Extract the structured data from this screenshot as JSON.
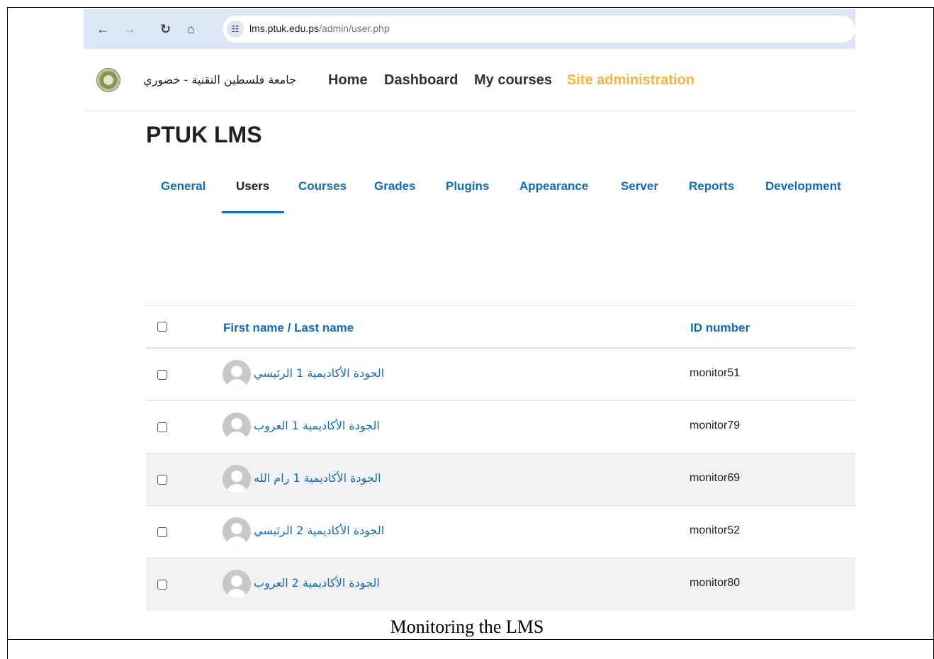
{
  "browser": {
    "url_host": "lms.ptuk.edu.ps",
    "url_path": "/admin/user.php"
  },
  "header": {
    "site_name": "جامعة فلسطين التقنية - خضوري",
    "nav": [
      "Home",
      "Dashboard",
      "My courses",
      "Site administration"
    ],
    "active_nav": "Site administration",
    "active_color": "#f0b740"
  },
  "page": {
    "title": "PTUK LMS",
    "tabs": [
      "General",
      "Users",
      "Courses",
      "Grades",
      "Plugins",
      "Appearance",
      "Server",
      "Reports",
      "Development"
    ],
    "active_tab": "Users"
  },
  "table": {
    "headers": {
      "name_first": "First name",
      "name_sep": " / ",
      "name_last": "Last name",
      "id": "ID number"
    },
    "rows": [
      {
        "name": "الجودة الأكاديمية 1 الرئيسي",
        "id": "monitor51"
      },
      {
        "name": "الجودة الأكاديمية 1 العروب",
        "id": "monitor79"
      },
      {
        "name": "الجودة الأكاديمية 1 رام الله",
        "id": "monitor69"
      },
      {
        "name": "الجودة الأكاديمية 2 الرئيسي",
        "id": "monitor52"
      },
      {
        "name": "الجودة الأكاديمية 2 العروب",
        "id": "monitor80"
      }
    ]
  },
  "caption": "Monitoring the LMS",
  "colors": {
    "link": "#0f6cbf",
    "accent": "#f0b740",
    "browser_bar": "#dde6f4"
  }
}
